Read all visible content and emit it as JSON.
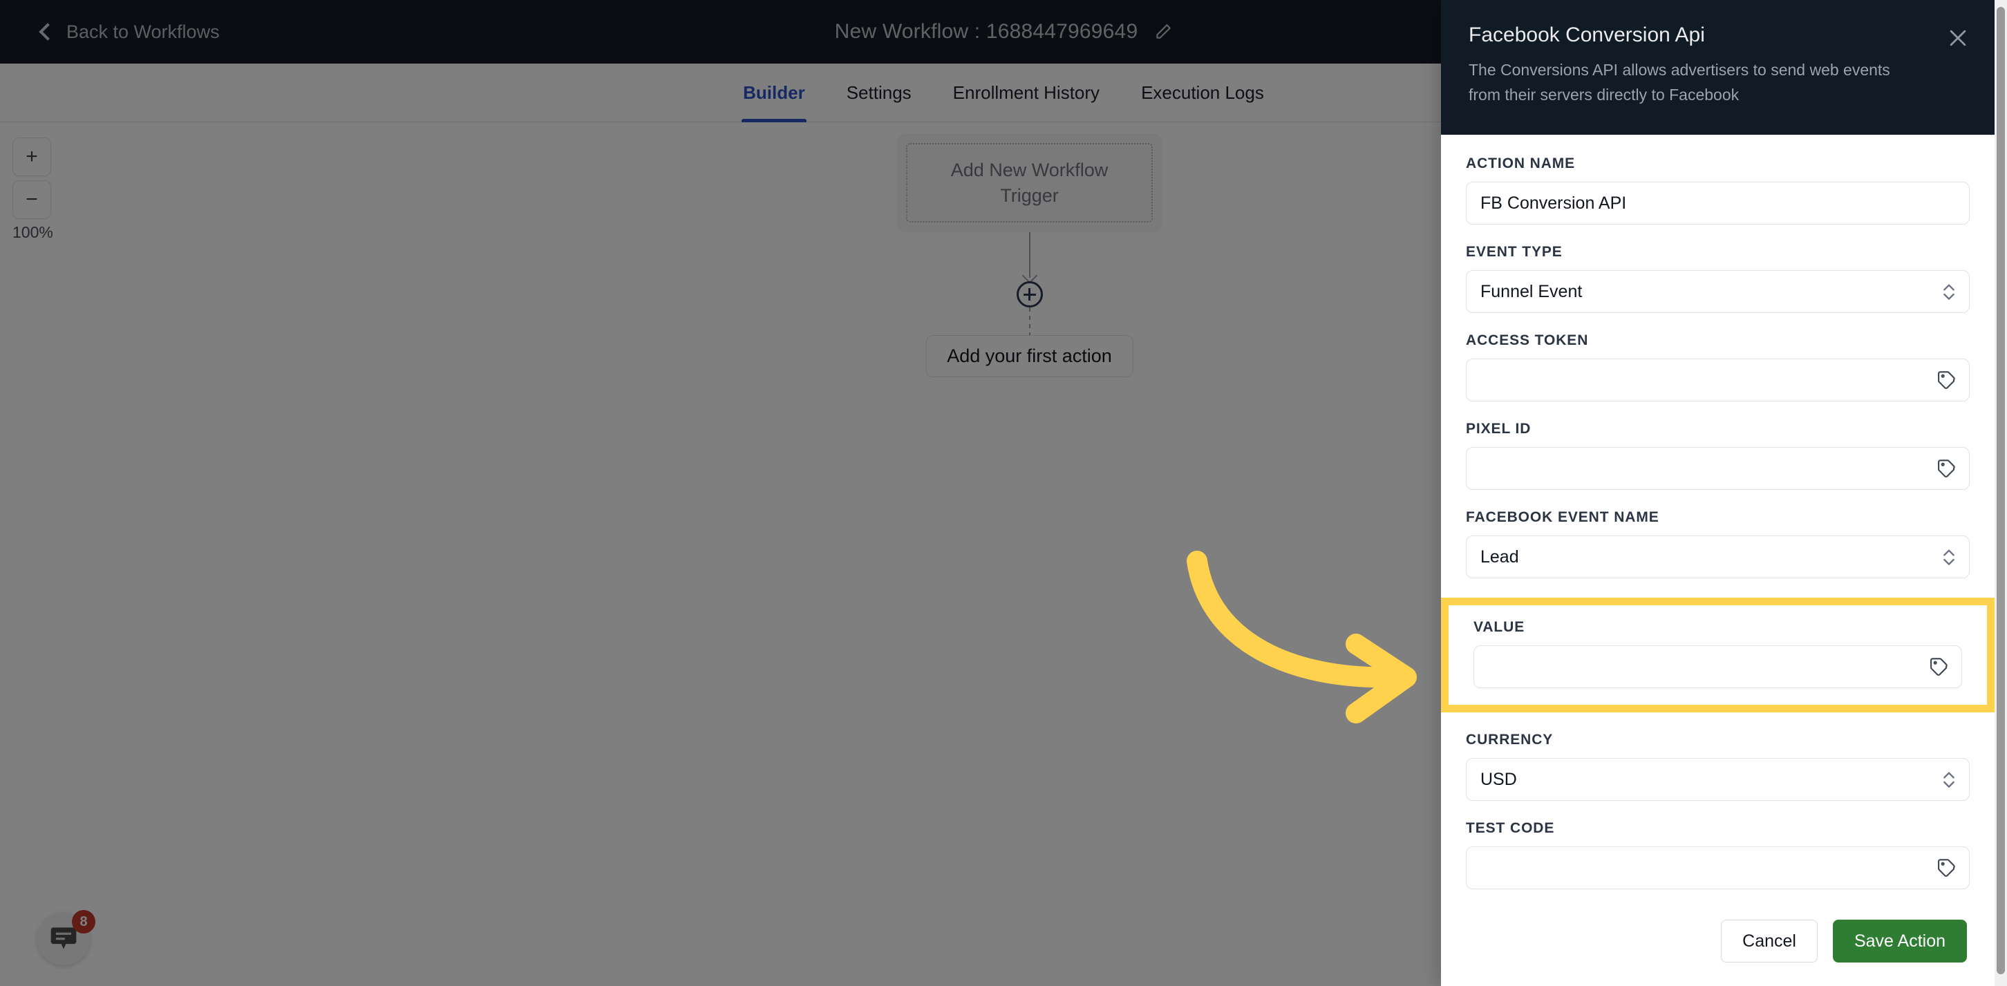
{
  "topbar": {
    "back_label": "Back to Workflows",
    "back_icon": "chevron-left-icon",
    "workflow_title": "New Workflow : 1688447969649",
    "edit_icon": "pencil-icon",
    "bg_color": "#181b25"
  },
  "tabs": [
    {
      "label": "Builder",
      "active": true
    },
    {
      "label": "Settings",
      "active": false
    },
    {
      "label": "Enrollment History",
      "active": false
    },
    {
      "label": "Execution Logs",
      "active": false
    }
  ],
  "tabs_accent_color": "#2d53c4",
  "canvas": {
    "zoom": {
      "in_label": "+",
      "out_label": "−",
      "level": "100%"
    },
    "trigger_node": {
      "label": "Add New Workflow Trigger"
    },
    "add_node_icon": "plus-circle-icon",
    "first_action_label": "Add your first action"
  },
  "chat_widget": {
    "icon": "chat-bubble-icon",
    "badge_count": "8",
    "badge_color": "#c0392b"
  },
  "panel": {
    "title": "Facebook Conversion Api",
    "subtitle": "The Conversions API allows advertisers to send web events from their servers directly to Facebook",
    "close_icon": "close-icon",
    "header_bg": "#101b26",
    "fields": [
      {
        "label": "ACTION NAME",
        "type": "text",
        "value": "FB Conversion API",
        "placeholder": "",
        "icon": ""
      },
      {
        "label": "EVENT TYPE",
        "type": "select",
        "value": "Funnel Event",
        "placeholder": "",
        "icon": "chevron-updown-icon"
      },
      {
        "label": "ACCESS TOKEN",
        "type": "text",
        "value": "",
        "placeholder": "",
        "icon": "tag-icon"
      },
      {
        "label": "PIXEL ID",
        "type": "text",
        "value": "",
        "placeholder": "",
        "icon": "tag-icon"
      },
      {
        "label": "FACEBOOK EVENT NAME",
        "type": "select",
        "value": "Lead",
        "placeholder": "",
        "icon": "chevron-updown-icon"
      }
    ],
    "highlighted_field": {
      "label": "VALUE",
      "type": "text",
      "value": "",
      "placeholder": "",
      "icon": "tag-icon",
      "highlight_color": "#ffd24d"
    },
    "fields_after": [
      {
        "label": "CURRENCY",
        "type": "select",
        "value": "USD",
        "placeholder": "",
        "icon": "chevron-updown-icon"
      },
      {
        "label": "TEST CODE",
        "type": "text",
        "value": "",
        "placeholder": "",
        "icon": "tag-icon"
      }
    ],
    "footer": {
      "cancel_label": "Cancel",
      "save_label": "Save Action",
      "save_color": "#2e7d32"
    }
  },
  "annotation": {
    "arrow_icon": "curved-arrow-right-icon",
    "arrow_color": "#ffd24d"
  }
}
